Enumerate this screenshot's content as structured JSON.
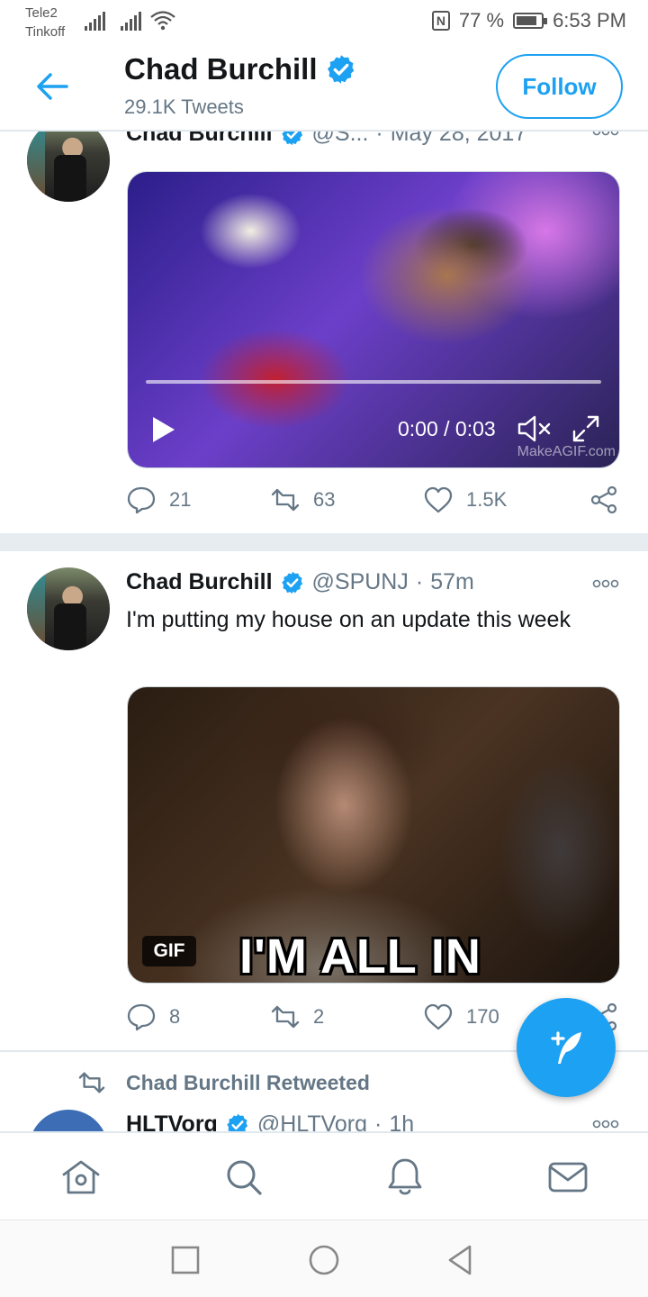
{
  "status_bar": {
    "carrier1": "Tele2",
    "carrier2": "Tinkoff",
    "battery": "77 %",
    "time": "6:53 PM"
  },
  "header": {
    "name": "Chad Burchill",
    "tweet_count": "29.1K Tweets",
    "follow_label": "Follow"
  },
  "tweets": [
    {
      "name": "Chad Burchill",
      "handle": "@S...",
      "time": "May 28, 2017",
      "video": {
        "time_label": "0:00 / 0:03",
        "watermark": "MakeAGIF.com"
      },
      "replies": "21",
      "retweets": "63",
      "likes": "1.5K"
    },
    {
      "name": "Chad Burchill",
      "handle": "@SPUNJ",
      "time": "57m",
      "text": "I'm putting my house on an update this week",
      "gif": {
        "badge": "GIF",
        "caption": "I'M ALL IN"
      },
      "replies": "8",
      "retweets": "2",
      "likes": "170"
    },
    {
      "retweeted_by": "Chad Burchill Retweeted",
      "name": "HLTVorg",
      "handle": "@HLTVorg",
      "time": "1h"
    }
  ],
  "colors": {
    "accent": "#1da1f2",
    "secondary_text": "#657786",
    "separator": "#e6ecf0"
  },
  "icons": [
    "back-arrow-icon",
    "verified-icon",
    "more-icon",
    "play-icon",
    "mute-icon",
    "expand-icon",
    "reply-icon",
    "retweet-icon",
    "like-icon",
    "share-icon",
    "compose-icon",
    "home-icon",
    "search-icon",
    "notifications-icon",
    "messages-icon"
  ]
}
